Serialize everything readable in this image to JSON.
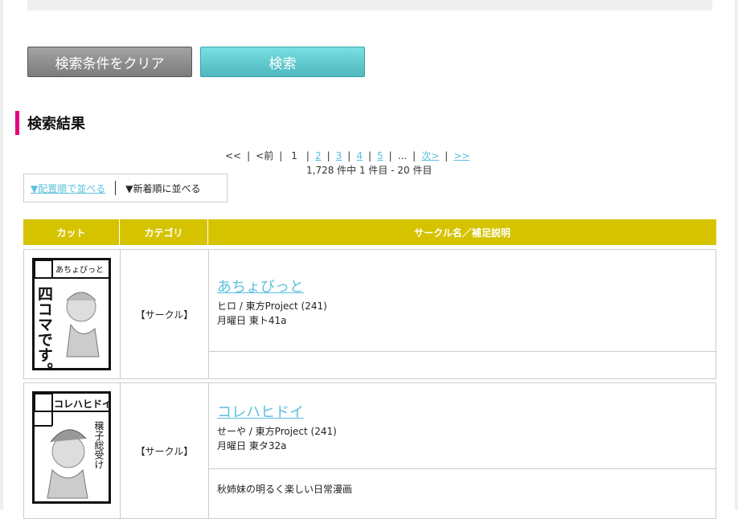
{
  "actions": {
    "clear_label": "検索条件をクリア",
    "search_label": "検索"
  },
  "results": {
    "heading": "検索結果",
    "pager": {
      "first": "<<",
      "prev": "<前",
      "current": "1",
      "pages": [
        "2",
        "3",
        "4",
        "5"
      ],
      "ellipsis": "...",
      "next": "次>",
      "last": ">>"
    },
    "count_text": "1,728 件中 1 件目 - 20 件目",
    "sort": {
      "by_layout": "▼配置順で並べる",
      "by_newest": "▼新着順に並べる"
    },
    "columns": {
      "cut": "カット",
      "category": "カテゴリ",
      "name": "サークル名／補足説明"
    },
    "rows": [
      {
        "name": "あちょびっと",
        "category": "【サークル】",
        "author_genre": "ヒロ / 東方Project (241)",
        "location": "月曜日 東ト41a",
        "description": "",
        "cut_title": "あちょびっと",
        "cut_text": "四コマです。"
      },
      {
        "name": "コレハヒドイ",
        "category": "【サークル】",
        "author_genre": "せーや / 東方Project (241)",
        "location": "月曜日 東タ32a",
        "description": "秋姉妹の明るく楽しい日常漫画",
        "cut_title": "コレハヒドイ",
        "cut_text": "穣子総受け"
      }
    ]
  }
}
